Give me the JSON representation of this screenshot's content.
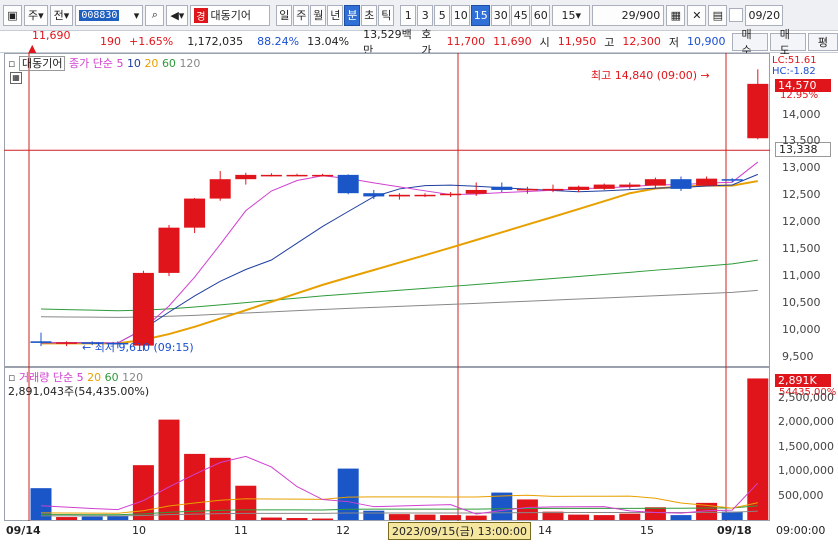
{
  "toolbar": {
    "market": "주",
    "prev_label": "전",
    "code": "008830",
    "search_icon": "search-icon",
    "speaker_icon": "speaker-icon",
    "badge": "경",
    "stock_name": "대동기어",
    "periods": [
      "일",
      "주",
      "월",
      "년",
      "분",
      "초",
      "틱"
    ],
    "selected_period": "분",
    "intervals": [
      "1",
      "3",
      "5",
      "10",
      "15",
      "30",
      "45",
      "60"
    ],
    "selected_interval": "15",
    "interval_value": "15",
    "count": "29/900",
    "date": "09/20"
  },
  "info": {
    "price": "11,690",
    "change": "190",
    "change_pct": "+1.65%",
    "volume": "1,172,035",
    "ratio": "88.24%",
    "turnover": "13.04%",
    "amount": "13,529백만",
    "ask_label": "호가",
    "ask": "11,700",
    "bid": "11,690",
    "open_label": "시",
    "open": "11,950",
    "high_label": "고",
    "high": "12,300",
    "low_label": "저",
    "low": "10,900",
    "buy": "매수",
    "sell": "매도",
    "close_label": "평"
  },
  "price_panel": {
    "name": "대동기어",
    "legend_prefix": "종가 단순",
    "ma": [
      "5",
      "10",
      "20",
      "60",
      "120"
    ],
    "high_note": "최고 14,840 (09:00)",
    "low_note": "최저 9,610 (09:15)",
    "lc": "LC:51.61",
    "hc": "HC:-1.82",
    "pct": "12.95%",
    "last_price": "14,570",
    "cursor_price": "13,338",
    "yticks": [
      "14,000",
      "13,500",
      "13,000",
      "12,500",
      "12,000",
      "11,500",
      "11,000",
      "10,500",
      "10,000",
      "9,500"
    ]
  },
  "volume_panel": {
    "name": "거래량",
    "legend_prefix": "단순",
    "ma": [
      "5",
      "20",
      "60",
      "120"
    ],
    "vol_text": "2,891,043주(54,435.00%)",
    "last_vol": "2,891K",
    "last_pct": "54435.00%",
    "yticks": [
      "2,500,000",
      "2,000,000",
      "1,500,000",
      "1,000,000",
      "500,000"
    ]
  },
  "xaxis": {
    "start": "09/14",
    "ticks": [
      "10",
      "11",
      "12",
      "14",
      "15"
    ],
    "end": "09/18",
    "cursor_label": "2023/09/15(금) 13:00:00",
    "right_label": "09:00:00"
  },
  "colors": {
    "up": "#e0151b",
    "down": "#1a56c8",
    "ma5": "#d040d0",
    "ma10": "#1f3fa0",
    "ma20": "#e8a000",
    "ma60": "#2e9a3a",
    "ma120": "#888888"
  },
  "chart_data": {
    "type": "candlestick",
    "price_range": [
      9350,
      15050
    ],
    "candles": [
      {
        "o": 9790,
        "h": 9950,
        "l": 9700,
        "c": 9760
      },
      {
        "o": 9760,
        "h": 9790,
        "l": 9700,
        "c": 9770
      },
      {
        "o": 9770,
        "h": 9790,
        "l": 9720,
        "c": 9760
      },
      {
        "o": 9760,
        "h": 9790,
        "l": 9660,
        "c": 9740
      },
      {
        "o": 9710,
        "h": 11100,
        "l": 9610,
        "c": 11060
      },
      {
        "o": 11060,
        "h": 11950,
        "l": 11000,
        "c": 11900
      },
      {
        "o": 11900,
        "h": 12450,
        "l": 11800,
        "c": 12440
      },
      {
        "o": 12440,
        "h": 12950,
        "l": 12400,
        "c": 12800
      },
      {
        "o": 12800,
        "h": 12920,
        "l": 12700,
        "c": 12880
      },
      {
        "o": 12880,
        "h": 12910,
        "l": 12850,
        "c": 12880
      },
      {
        "o": 12880,
        "h": 12900,
        "l": 12860,
        "c": 12880
      },
      {
        "o": 12880,
        "h": 12900,
        "l": 12850,
        "c": 12880
      },
      {
        "o": 12880,
        "h": 12890,
        "l": 12520,
        "c": 12540
      },
      {
        "o": 12540,
        "h": 12600,
        "l": 12430,
        "c": 12480
      },
      {
        "o": 12480,
        "h": 12540,
        "l": 12420,
        "c": 12510
      },
      {
        "o": 12510,
        "h": 12540,
        "l": 12470,
        "c": 12510
      },
      {
        "o": 12510,
        "h": 12560,
        "l": 12470,
        "c": 12530
      },
      {
        "o": 12530,
        "h": 12740,
        "l": 12490,
        "c": 12600
      },
      {
        "o": 12660,
        "h": 12740,
        "l": 12560,
        "c": 12600
      },
      {
        "o": 12600,
        "h": 12660,
        "l": 12530,
        "c": 12620
      },
      {
        "o": 12620,
        "h": 12700,
        "l": 12560,
        "c": 12620
      },
      {
        "o": 12600,
        "h": 12680,
        "l": 12560,
        "c": 12660
      },
      {
        "o": 12620,
        "h": 12720,
        "l": 12600,
        "c": 12700
      },
      {
        "o": 12660,
        "h": 12740,
        "l": 12620,
        "c": 12700
      },
      {
        "o": 12680,
        "h": 12830,
        "l": 12620,
        "c": 12800
      },
      {
        "o": 12800,
        "h": 12850,
        "l": 12580,
        "c": 12620
      },
      {
        "o": 12680,
        "h": 12850,
        "l": 12680,
        "c": 12810
      },
      {
        "o": 12800,
        "h": 12820,
        "l": 12740,
        "c": 12790
      },
      {
        "o": 13560,
        "h": 14840,
        "l": 13540,
        "c": 14570
      }
    ],
    "volume": [
      650,
      60,
      70,
      80,
      1120,
      2050,
      1350,
      1270,
      700,
      50,
      40,
      30,
      1050,
      190,
      120,
      110,
      100,
      90,
      560,
      420,
      170,
      110,
      100,
      130,
      260,
      100,
      350,
      170,
      2891
    ],
    "volume_unit": "thousand shares",
    "volume_range": [
      0,
      2900
    ]
  }
}
